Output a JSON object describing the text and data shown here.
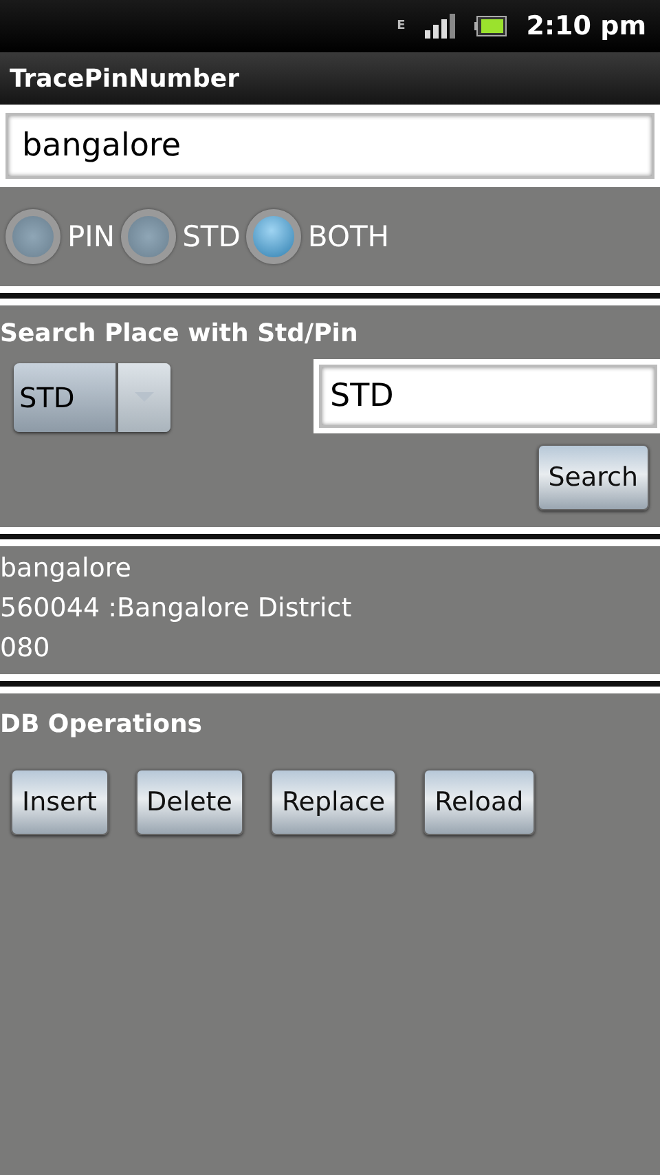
{
  "status_bar": {
    "time": "2:10 pm",
    "network": "E"
  },
  "app_bar": {
    "title": "TracePinNumber"
  },
  "query_field": {
    "value": "bangalore"
  },
  "modes": [
    {
      "label": "PIN",
      "selected": false
    },
    {
      "label": "STD",
      "selected": false
    },
    {
      "label": "BOTH",
      "selected": true
    }
  ],
  "search_section": {
    "heading": "Search Place with Std/Pin",
    "spinner": {
      "value": "STD"
    },
    "field": {
      "value": "STD"
    },
    "button": "Search"
  },
  "result": {
    "lines": [
      "bangalore",
      "560044 :Bangalore District",
      "080"
    ]
  },
  "db_section": {
    "heading": "DB Operations",
    "buttons": [
      "Insert",
      "Delete",
      "Replace",
      "Reload"
    ]
  }
}
